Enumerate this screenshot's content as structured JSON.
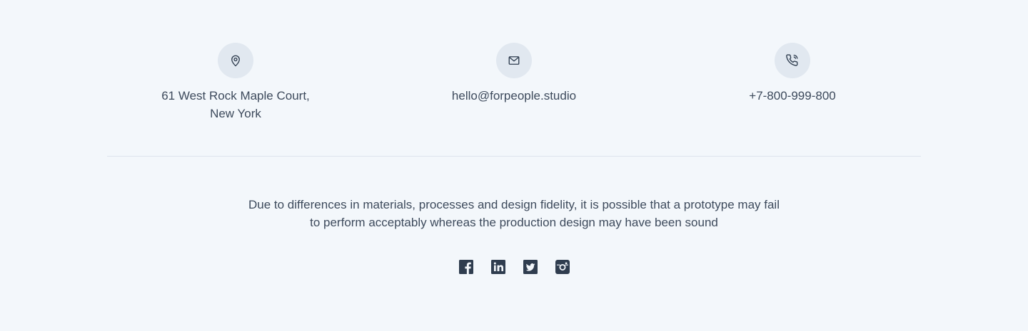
{
  "contacts": {
    "address": {
      "icon": "location-pin-icon",
      "line1": "61 West Rock Maple Court,",
      "line2": "New York"
    },
    "email": {
      "icon": "mail-icon",
      "value": "hello@forpeople.studio"
    },
    "phone": {
      "icon": "phone-icon",
      "value": "+7-800-999-800"
    }
  },
  "disclaimer": {
    "line1": "Due to differences in materials, processes and design fidelity, it is possible that a prototype may fail",
    "line2": "to perform acceptably whereas the production design may have been sound"
  },
  "social": [
    {
      "name": "facebook",
      "icon": "facebook-icon"
    },
    {
      "name": "linkedin",
      "icon": "linkedin-icon"
    },
    {
      "name": "twitter",
      "icon": "twitter-icon"
    },
    {
      "name": "instagram",
      "icon": "instagram-icon"
    }
  ],
  "colors": {
    "background": "#f3f7fb",
    "icon_circle": "#e1e8f0",
    "text": "#3d4a5c",
    "icon": "#2f3d4f",
    "divider": "#dde4ec"
  }
}
